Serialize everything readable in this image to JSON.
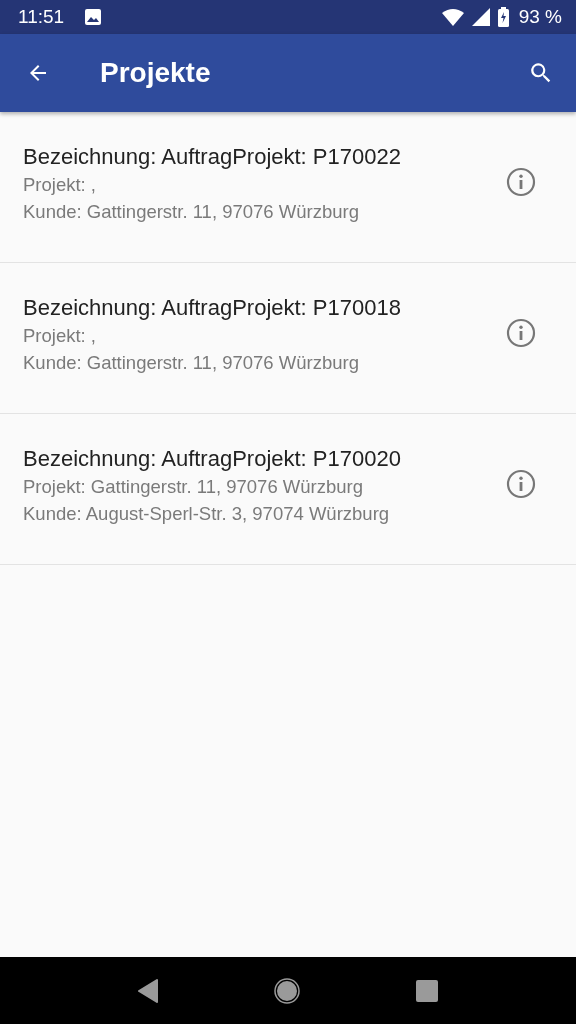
{
  "status_bar": {
    "time": "11:51",
    "battery": "93 %"
  },
  "app_bar": {
    "title": "Projekte"
  },
  "items": [
    {
      "title": "Bezeichnung: AuftragProjekt: P170022",
      "project": "Projekt: ,",
      "customer": "Kunde: Gattingerstr. 11, 97076 Würzburg"
    },
    {
      "title": "Bezeichnung: AuftragProjekt: P170018",
      "project": "Projekt: ,",
      "customer": "Kunde: Gattingerstr. 11, 97076 Würzburg"
    },
    {
      "title": "Bezeichnung: AuftragProjekt: P170020",
      "project": "Projekt: Gattingerstr. 11, 97076 Würzburg",
      "customer": "Kunde: August-Sperl-Str. 3, 97074 Würzburg"
    }
  ]
}
